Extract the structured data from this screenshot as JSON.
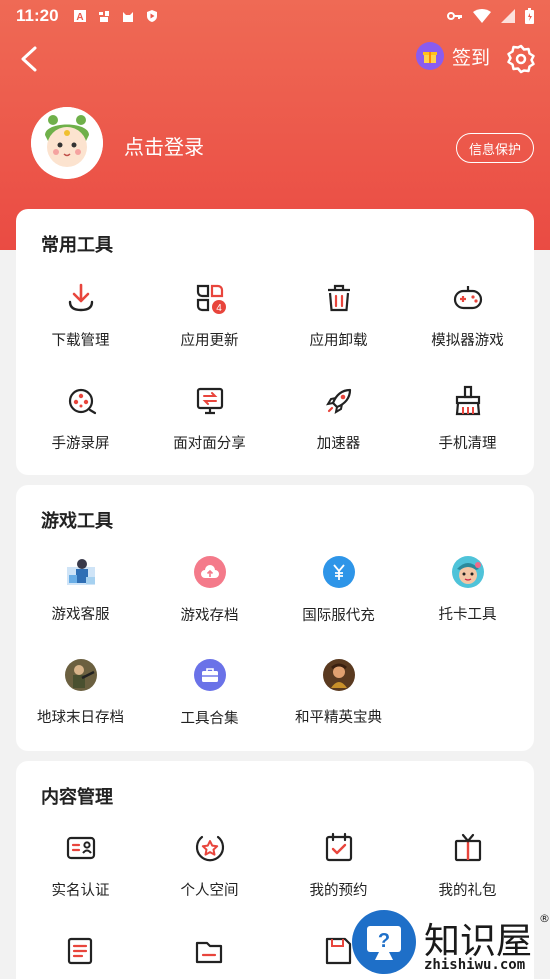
{
  "status_bar": {
    "time": "11:20",
    "left_icons": [
      "a-box-icon",
      "bug-icon",
      "cat-icon",
      "shield-icon"
    ],
    "right_icons": [
      "key-icon",
      "wifi-icon",
      "signal-icon",
      "battery-icon"
    ]
  },
  "header": {
    "signin_label": "签到",
    "login_text": "点击登录",
    "privacy_button": "信息保护"
  },
  "colors": {
    "header_top": "#ef6a55",
    "header_bottom": "#ea4b43",
    "icon_red": "#e8453c",
    "gift_purple": "#8a5cf0"
  },
  "sections": [
    {
      "title": "常用工具",
      "items": [
        {
          "label": "下载管理",
          "icon": "download-icon"
        },
        {
          "label": "应用更新",
          "icon": "app-update-icon",
          "badge": "4"
        },
        {
          "label": "应用卸载",
          "icon": "trash-icon"
        },
        {
          "label": "模拟器游戏",
          "icon": "gamepad-icon"
        },
        {
          "label": "手游录屏",
          "icon": "film-reel-icon"
        },
        {
          "label": "面对面分享",
          "icon": "transfer-icon"
        },
        {
          "label": "加速器",
          "icon": "rocket-icon"
        },
        {
          "label": "手机清理",
          "icon": "broom-icon"
        }
      ]
    },
    {
      "title": "游戏工具",
      "items": [
        {
          "label": "游戏客服",
          "icon": "customer-service-icon"
        },
        {
          "label": "游戏存档",
          "icon": "cloud-upload-icon"
        },
        {
          "label": "国际服代充",
          "icon": "yuan-icon"
        },
        {
          "label": "托卡工具",
          "icon": "toca-character-icon"
        },
        {
          "label": "地球末日存档",
          "icon": "soldier-game-icon"
        },
        {
          "label": "工具合集",
          "icon": "toolbox-icon"
        },
        {
          "label": "和平精英宝典",
          "icon": "pubg-character-icon"
        }
      ]
    },
    {
      "title": "内容管理",
      "items": [
        {
          "label": "实名认证",
          "icon": "id-card-icon"
        },
        {
          "label": "个人空间",
          "icon": "star-badge-icon"
        },
        {
          "label": "我的预约",
          "icon": "calendar-check-icon"
        },
        {
          "label": "我的礼包",
          "icon": "gift-box-icon"
        }
      ]
    }
  ],
  "watermark": {
    "title": "知识屋",
    "registered": "®",
    "subtitle": "zhishiwu.com"
  }
}
